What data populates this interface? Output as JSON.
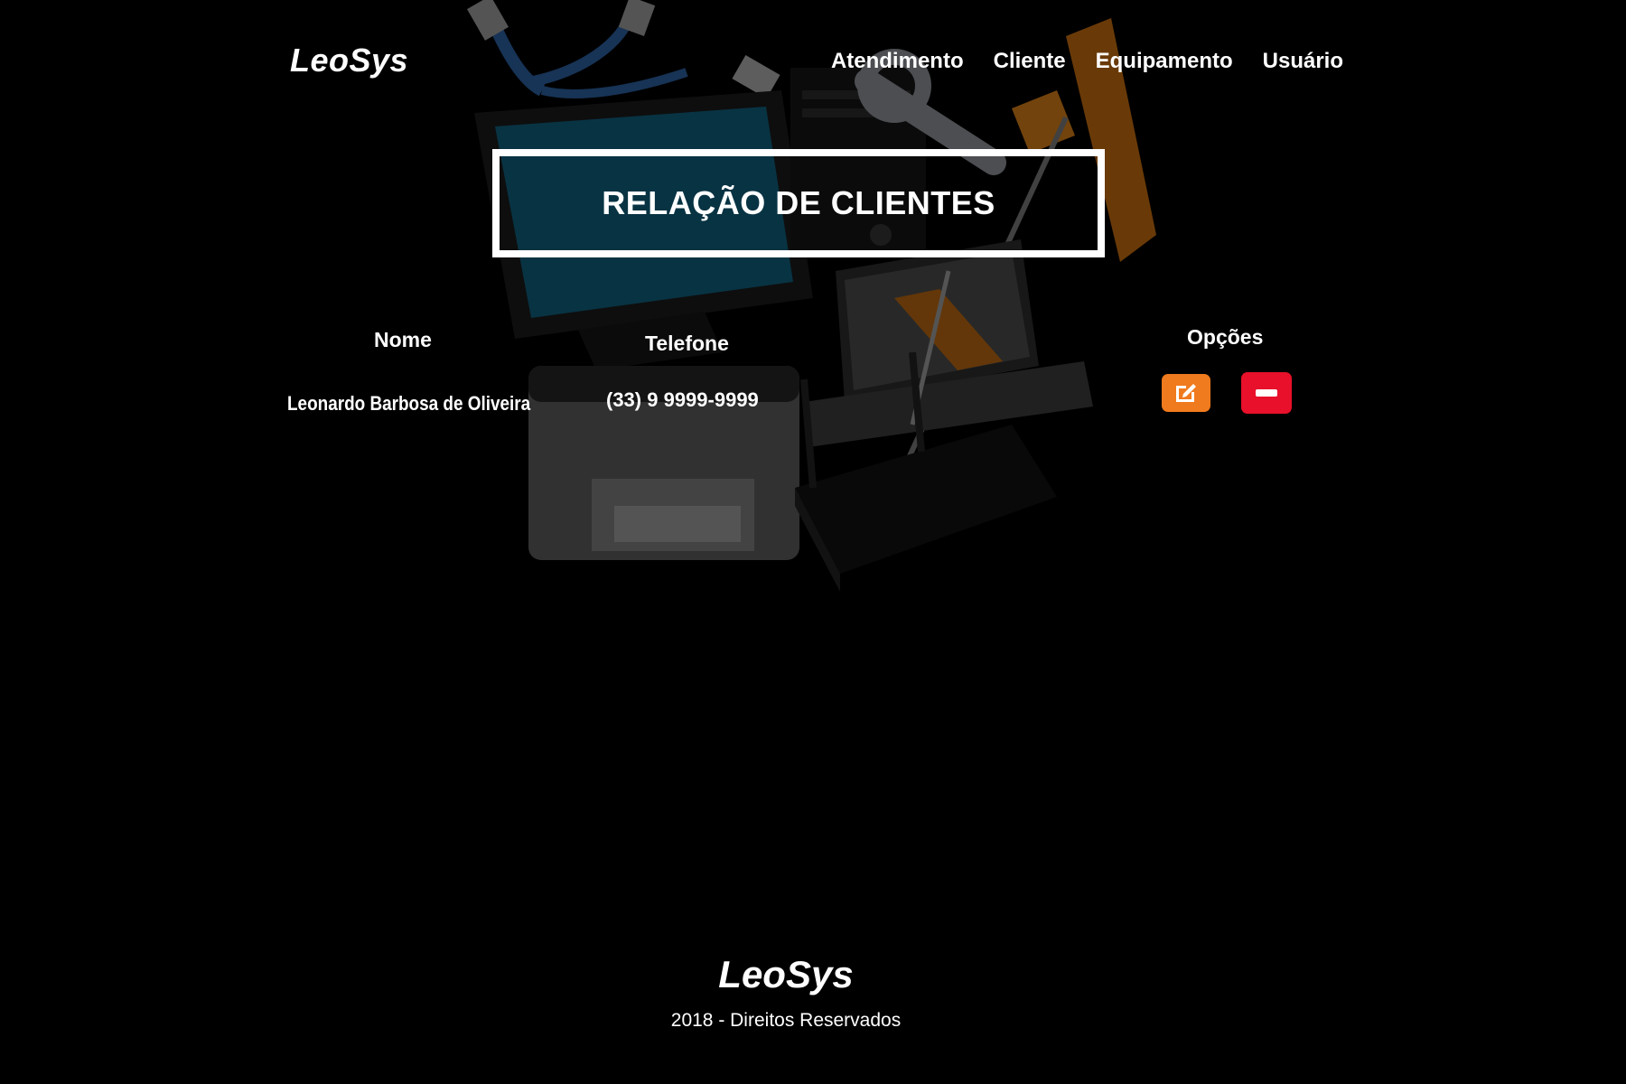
{
  "header": {
    "brand": "LeoSys",
    "nav": [
      "Atendimento",
      "Cliente",
      "Equipamento",
      "Usuário"
    ]
  },
  "main": {
    "title": "RELAÇÃO DE CLIENTES",
    "table": {
      "columns": [
        "Nome",
        "Telefone",
        "Opções"
      ],
      "rows": [
        {
          "nome": "Leonardo Barbosa de Oliveira",
          "telefone": "(33) 9 9999-9999"
        }
      ]
    },
    "actions": {
      "edit_icon": "edit-icon",
      "remove_icon": "minus-icon"
    }
  },
  "footer": {
    "brand": "LeoSys",
    "text": "2018 - Direitos Reservados"
  },
  "colors": {
    "background": "#000000",
    "text": "#ffffff",
    "edit_button": "#f07a1e",
    "remove_button": "#e8102a"
  }
}
